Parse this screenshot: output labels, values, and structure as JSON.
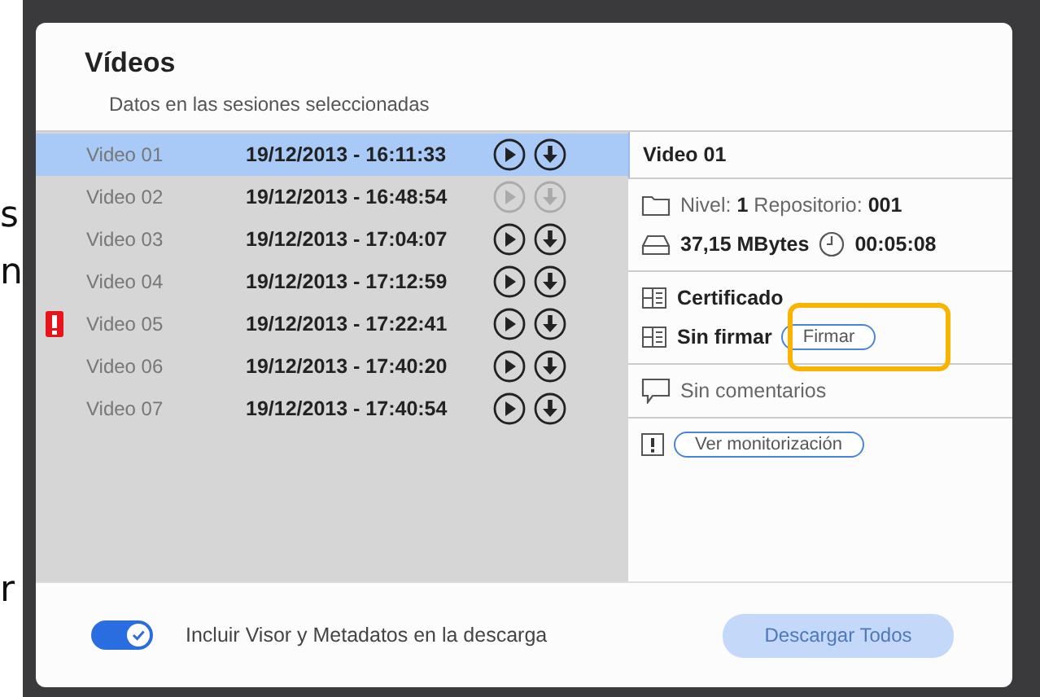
{
  "background_text": [
    "s",
    "n",
    "r"
  ],
  "dialog": {
    "title": "Vídeos",
    "subtitle": "Datos en las sesiones seleccionadas"
  },
  "videos": [
    {
      "name": "Video 01",
      "datetime": "19/12/2013 - 16:11:33",
      "selected": true,
      "disabled": false,
      "alert": false
    },
    {
      "name": "Video 02",
      "datetime": "19/12/2013 - 16:48:54",
      "selected": false,
      "disabled": true,
      "alert": false
    },
    {
      "name": "Video 03",
      "datetime": "19/12/2013 - 17:04:07",
      "selected": false,
      "disabled": false,
      "alert": false
    },
    {
      "name": "Video 04",
      "datetime": "19/12/2013 - 17:12:59",
      "selected": false,
      "disabled": false,
      "alert": false
    },
    {
      "name": "Video 05",
      "datetime": "19/12/2013 - 17:22:41",
      "selected": false,
      "disabled": false,
      "alert": true
    },
    {
      "name": "Video 06",
      "datetime": "19/12/2013 - 17:40:20",
      "selected": false,
      "disabled": false,
      "alert": false
    },
    {
      "name": "Video 07",
      "datetime": "19/12/2013 - 17:40:54",
      "selected": false,
      "disabled": false,
      "alert": false
    }
  ],
  "details": {
    "title": "Video 01",
    "location": "Nivel: **1** Repositorio: **001**",
    "size": "37,15 MBytes",
    "duration": "00:05:08",
    "certificate": "Certificado",
    "signature": "Sin firmar",
    "sign_button": "Firmar",
    "comments": "Sin comentarios",
    "monitor_button": "Ver monitorización"
  },
  "footer": {
    "toggle": {
      "label": "Incluir Visor y Metadatos en la descarga",
      "on": true
    },
    "download_all": {
      "label": "Descargar Todos",
      "disabled": true
    }
  },
  "highlight": {
    "shown": true
  }
}
